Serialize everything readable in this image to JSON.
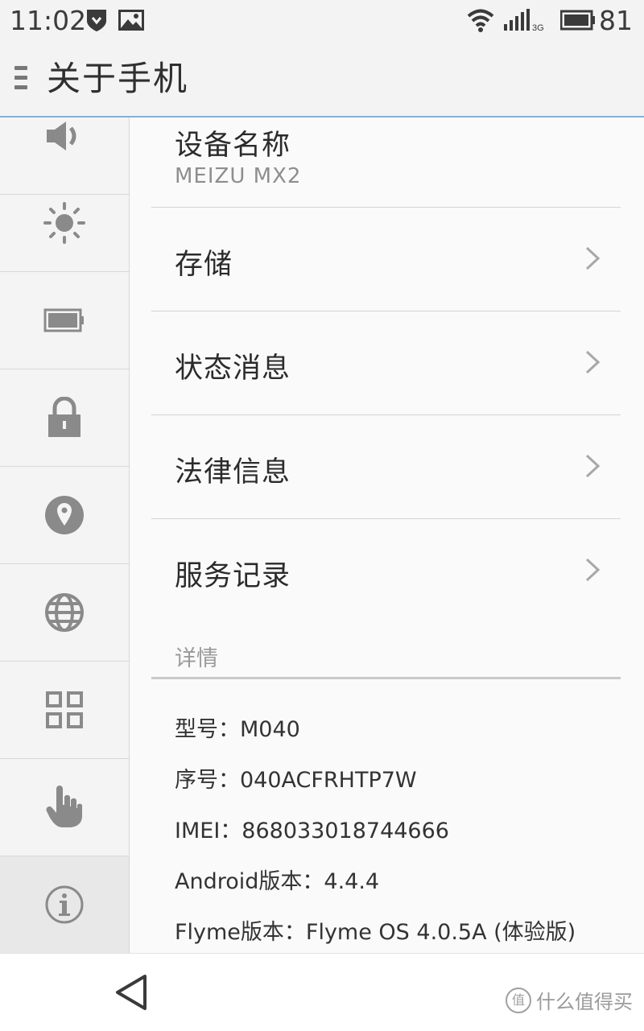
{
  "status_bar": {
    "time": "11:02",
    "battery_percent": "81",
    "network_type": "3G",
    "icons": [
      "shield-notification-icon",
      "image-notification-icon",
      "wifi-icon",
      "signal-icon",
      "battery-icon"
    ]
  },
  "action_bar": {
    "title": "关于手机",
    "menu_icon": "menu-icon"
  },
  "sidebar": {
    "items": [
      {
        "icon": "volume-icon"
      },
      {
        "icon": "brightness-icon"
      },
      {
        "icon": "battery-icon"
      },
      {
        "icon": "lock-icon"
      },
      {
        "icon": "location-icon"
      },
      {
        "icon": "globe-icon"
      },
      {
        "icon": "apps-grid-icon"
      },
      {
        "icon": "touch-hand-icon"
      },
      {
        "icon": "info-icon",
        "active": true
      }
    ]
  },
  "main": {
    "device_name": {
      "title": "设备名称",
      "value": "MEIZU MX2"
    },
    "menu_rows": [
      {
        "label": "存储"
      },
      {
        "label": "状态消息"
      },
      {
        "label": "法律信息"
      },
      {
        "label": "服务记录"
      }
    ],
    "details_header": "详情",
    "details": [
      "型号：M040",
      "序号：040ACFRHTP7W",
      "IMEI：868033018744666",
      "Android版本：4.4.4",
      "Flyme版本：Flyme OS 4.0.5A (体验版)"
    ]
  },
  "nav_bar": {
    "back_icon": "back-triangle-icon",
    "watermark": "什么值得买",
    "watermark_badge": "值"
  },
  "colors": {
    "accent_line": "#7fb3dd",
    "icon_gray": "#8a8a8a",
    "background": "#fafafa"
  }
}
